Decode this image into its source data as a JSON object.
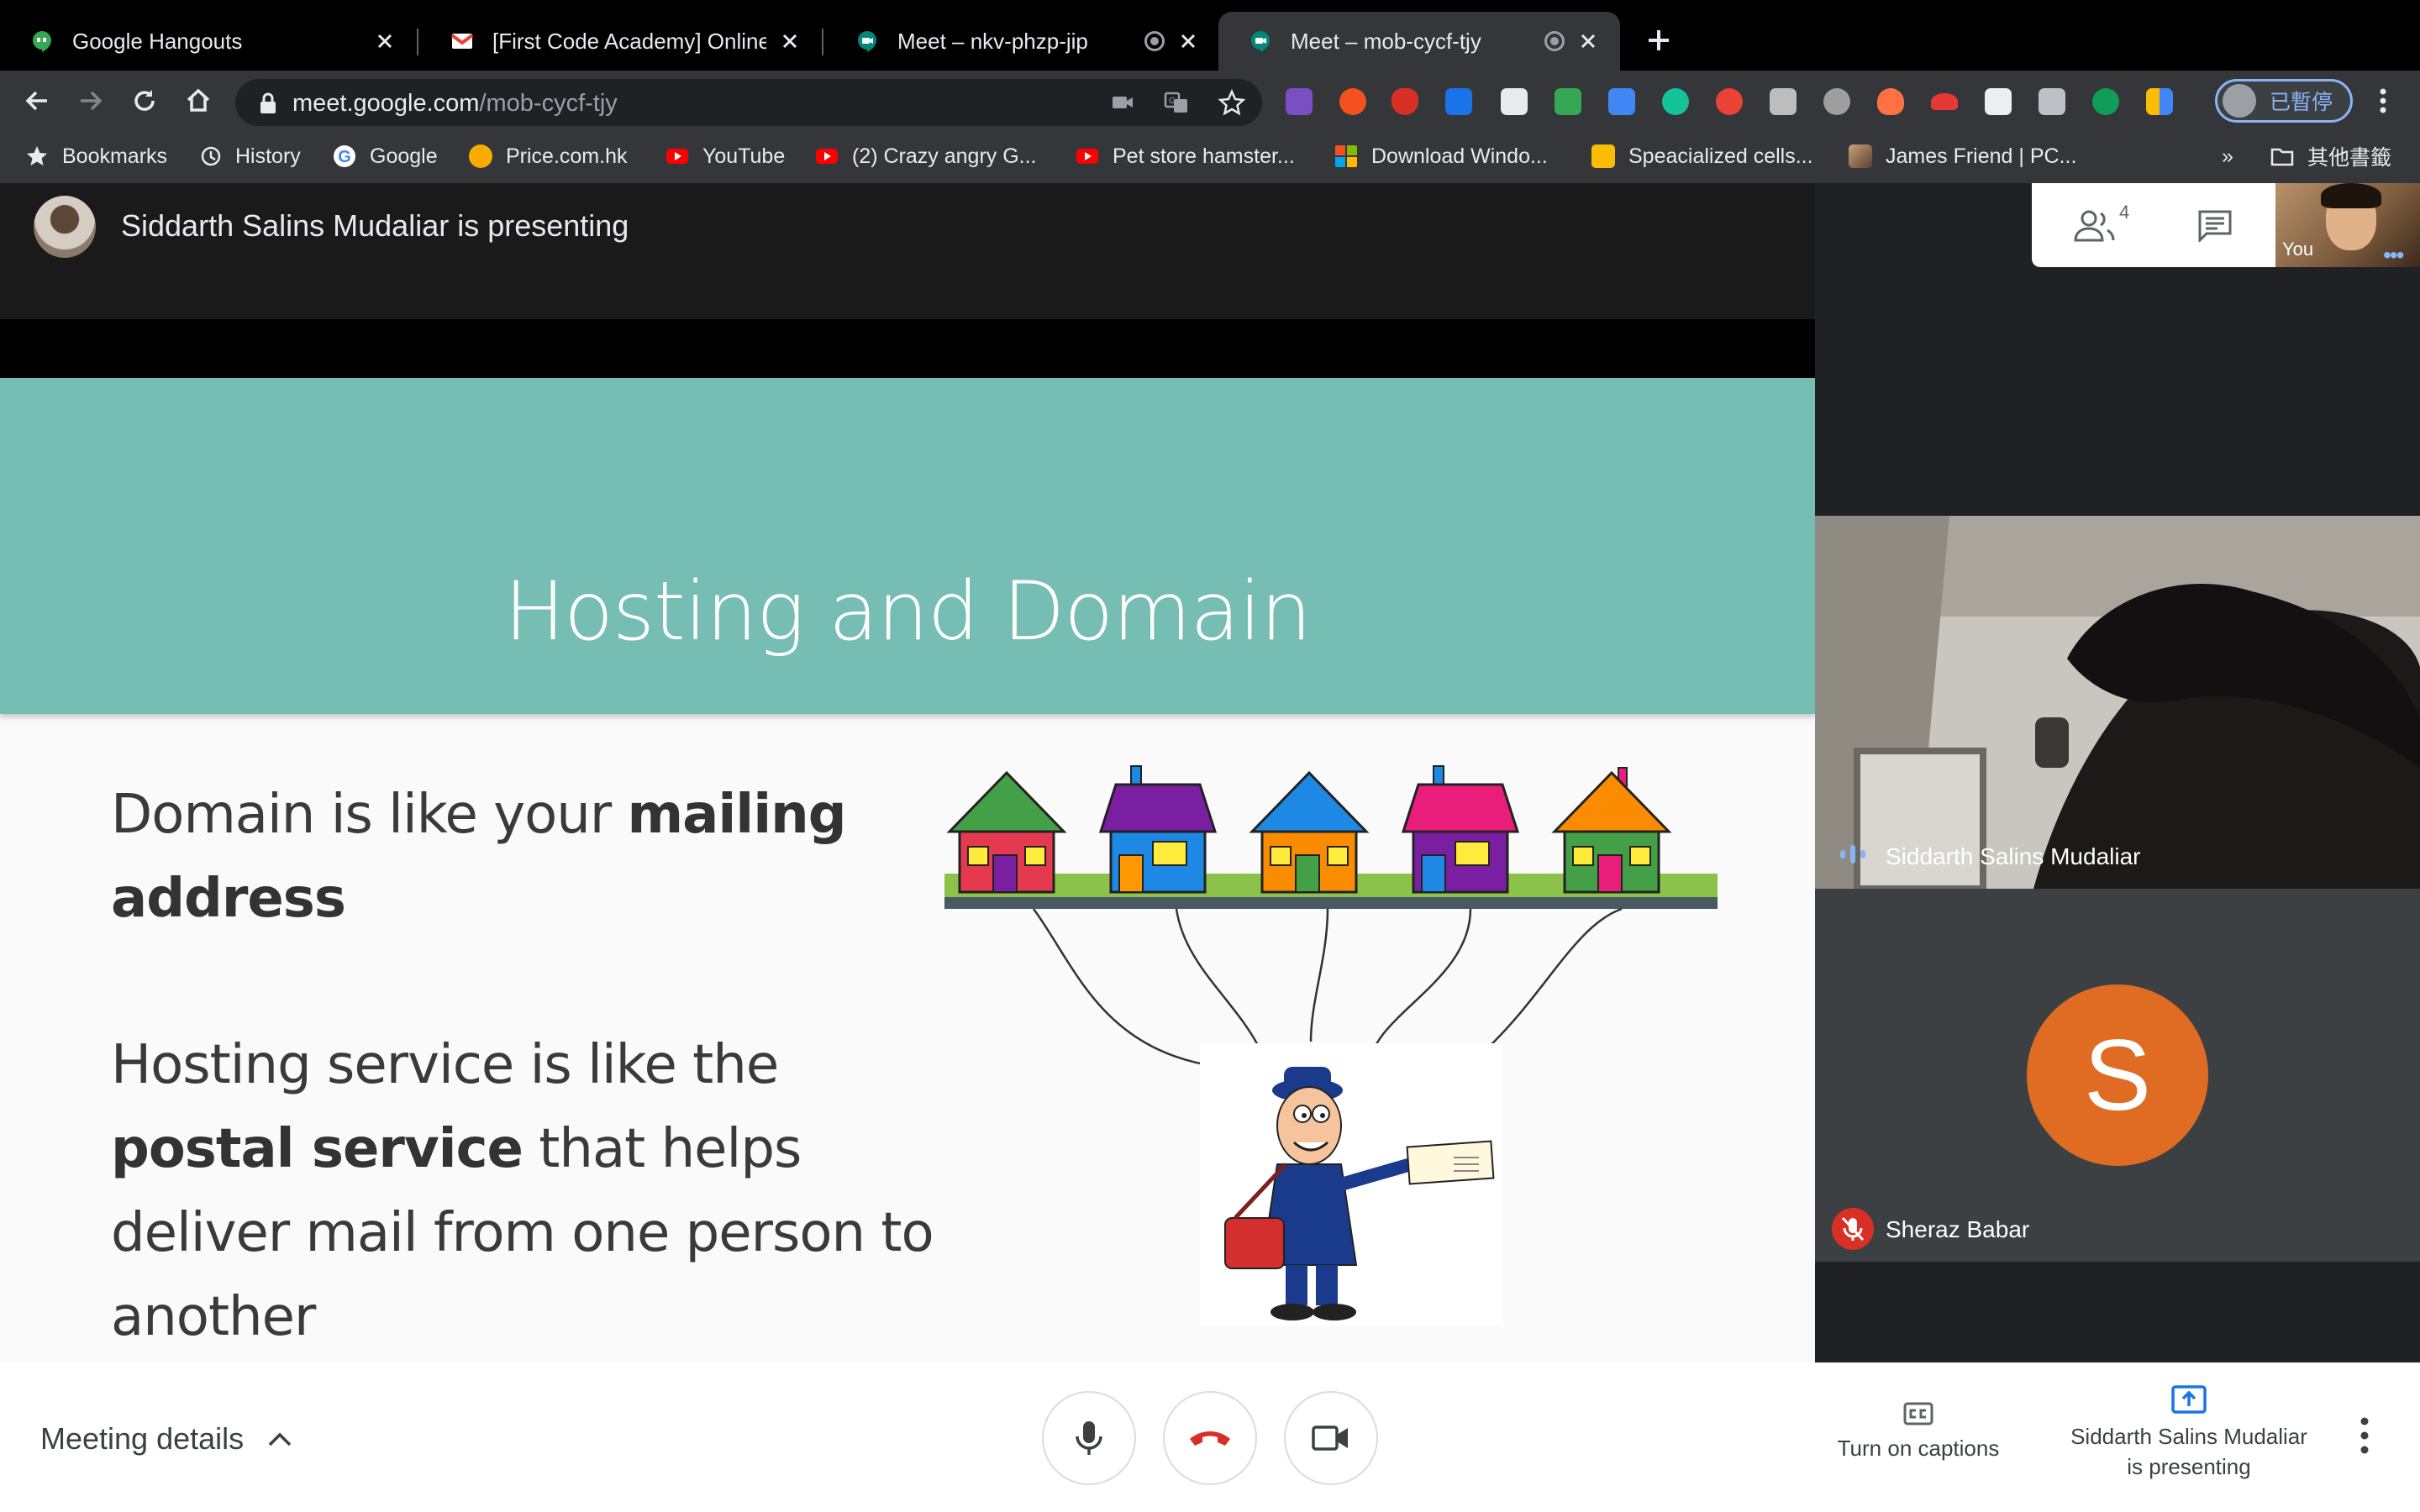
{
  "browser": {
    "tabs": [
      {
        "title": "Google Hangouts",
        "icon": "hangouts-icon",
        "active": false
      },
      {
        "title": "[First Code Academy] Online M",
        "icon": "gmail-icon",
        "active": false
      },
      {
        "title": "Meet – nkv-phzp-jip",
        "icon": "meet-icon",
        "active": false
      },
      {
        "title": "Meet – mob-cycf-tjy",
        "icon": "meet-icon",
        "active": true
      }
    ],
    "url_host": "meet.google.com",
    "url_path": "/mob-cycf-tjy",
    "profile_label": "已暫停",
    "extensions": [
      "tweak-ext-icon",
      "infinity-ext-icon",
      "shield-ext-icon",
      "resize-ext-icon",
      "library-ext-icon",
      "lock-ext-icon",
      "translate-ext-icon",
      "grammarly-icon",
      "hand-ext-icon",
      "bookmark-ext-icon",
      "globe-ext-icon",
      "fire-ext-icon",
      "ufo-ext-icon",
      "upload-ext-icon",
      "edit-ext-icon",
      "w-ext-icon",
      "calendar-ext-icon"
    ],
    "bookmarks": [
      {
        "label": "Bookmarks",
        "icon": "star-icon"
      },
      {
        "label": "History",
        "icon": "history-icon"
      },
      {
        "label": "Google",
        "icon": "google-icon"
      },
      {
        "label": "Price.com.hk",
        "icon": "price-icon"
      },
      {
        "label": "YouTube",
        "icon": "youtube-icon"
      },
      {
        "label": "(2) Crazy angry G...",
        "icon": "youtube-icon"
      },
      {
        "label": "Pet store hamster...",
        "icon": "youtube-icon"
      },
      {
        "label": "Download Windo...",
        "icon": "windows-icon"
      },
      {
        "label": "Speacialized cells...",
        "icon": "slides-icon"
      },
      {
        "label": "James Friend | PC...",
        "icon": "photo-icon"
      }
    ],
    "bookmarks_overflow": "»",
    "other_bookmarks": "其他書籤"
  },
  "meet": {
    "presenting_banner": "Siddarth Salins Mudaliar is presenting",
    "participant_count": "4",
    "self_label": "You",
    "slide": {
      "title": "Hosting and Domain",
      "line1_pre": "Domain is like your ",
      "line1_bold": "mailing address",
      "line2_pre": "Hosting service is like the ",
      "line2_bold1": "postal service",
      "line2_post": " that helps deliver mail from one person to another"
    },
    "participants": [
      {
        "name": "Siddarth Salins Mudaliar",
        "speaking": true
      },
      {
        "name": "Sheraz Babar",
        "initial": "S",
        "muted": true,
        "avatar_color": "#e06c23"
      }
    ],
    "bottom": {
      "meeting_details": "Meeting details",
      "captions_label": "Turn on captions",
      "presenting_label_1": "Siddarth Salins Mudaliar",
      "presenting_label_2": "is presenting"
    }
  },
  "colors": {
    "slide_header": "#76bdb4",
    "hangup_red": "#d93025",
    "accent_blue": "#8ab4f8",
    "presenting_teal": "#1a73e8"
  }
}
